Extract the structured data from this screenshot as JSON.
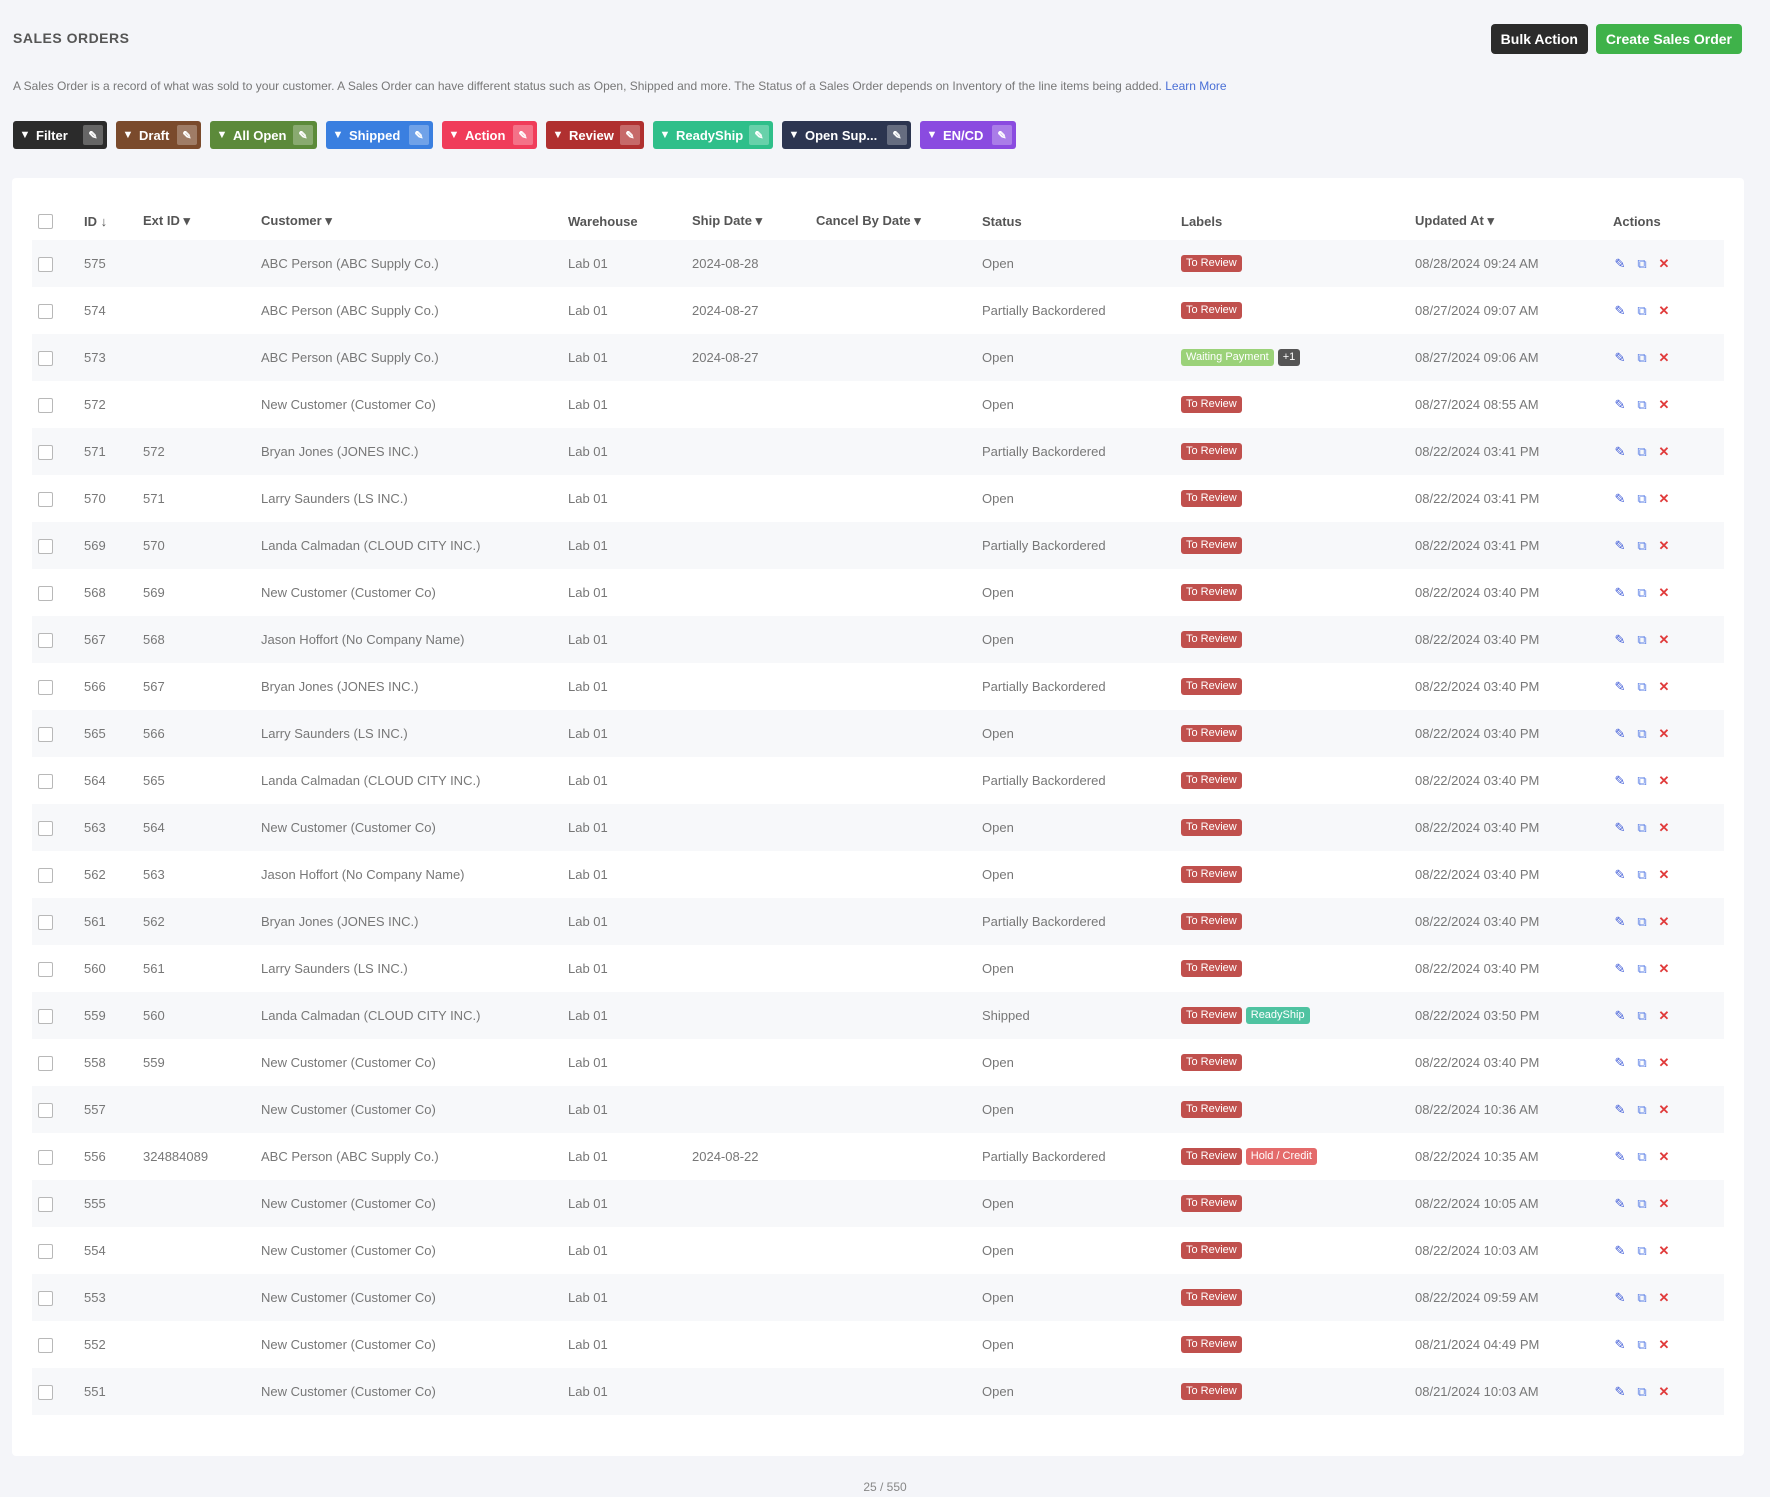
{
  "page": {
    "title": "SALES ORDERS",
    "description": "A Sales Order is a record of what was sold to your customer. A Sales Order can have different status such as Open, Shipped and more. The Status of a Sales Order depends on Inventory of the line items being added.",
    "learn_more": "Learn More",
    "bulk_action": "Bulk Action",
    "create_button": "Create Sales Order"
  },
  "filters": [
    {
      "label": "Filter",
      "color": "#2b2b2b",
      "icon": "filter-icon"
    },
    {
      "label": "Draft",
      "color": "#7a4a2c",
      "icon": "filter-icon"
    },
    {
      "label": "All Open",
      "color": "#5c8a3a",
      "icon": "filter-icon"
    },
    {
      "label": "Shipped",
      "color": "#3a7fe0",
      "icon": "filter-icon"
    },
    {
      "label": "Action",
      "color": "#f03c5a",
      "icon": "filter-icon"
    },
    {
      "label": "Review",
      "color": "#b03030",
      "icon": "filter-icon"
    },
    {
      "label": "ReadyShip",
      "color": "#2fbf8a",
      "icon": "filter-icon"
    },
    {
      "label": "Open Sup...",
      "color": "#2c3550",
      "icon": "filter-icon"
    },
    {
      "label": "EN/CD",
      "color": "#8a4be0",
      "icon": "filter-icon"
    }
  ],
  "table": {
    "columns": [
      "ID",
      "Ext ID",
      "Customer",
      "Warehouse",
      "Ship Date",
      "Cancel By Date",
      "Status",
      "Labels",
      "Updated At",
      "Actions"
    ],
    "rows": [
      {
        "id": "575",
        "ext_id": "",
        "customer": "ABC Person (ABC Supply Co.)",
        "warehouse": "Lab 01",
        "ship_date": "2024-08-28",
        "cancel_by": "",
        "status": "Open",
        "labels": [
          "To Review"
        ],
        "updated": "08/28/2024 09:24 AM"
      },
      {
        "id": "574",
        "ext_id": "",
        "customer": "ABC Person (ABC Supply Co.)",
        "warehouse": "Lab 01",
        "ship_date": "2024-08-27",
        "cancel_by": "",
        "status": "Partially Backordered",
        "labels": [
          "To Review"
        ],
        "updated": "08/27/2024 09:07 AM"
      },
      {
        "id": "573",
        "ext_id": "",
        "customer": "ABC Person (ABC Supply Co.)",
        "warehouse": "Lab 01",
        "ship_date": "2024-08-27",
        "cancel_by": "",
        "status": "Open",
        "labels": [
          "Waiting Payment",
          "+1"
        ],
        "updated": "08/27/2024 09:06 AM"
      },
      {
        "id": "572",
        "ext_id": "",
        "customer": "New Customer (Customer Co)",
        "warehouse": "Lab 01",
        "ship_date": "",
        "cancel_by": "",
        "status": "Open",
        "labels": [
          "To Review"
        ],
        "updated": "08/27/2024 08:55 AM"
      },
      {
        "id": "571",
        "ext_id": "572",
        "customer": "Bryan Jones (JONES INC.)",
        "warehouse": "Lab 01",
        "ship_date": "",
        "cancel_by": "",
        "status": "Partially Backordered",
        "labels": [
          "To Review"
        ],
        "updated": "08/22/2024 03:41 PM"
      },
      {
        "id": "570",
        "ext_id": "571",
        "customer": "Larry Saunders (LS INC.)",
        "warehouse": "Lab 01",
        "ship_date": "",
        "cancel_by": "",
        "status": "Open",
        "labels": [
          "To Review"
        ],
        "updated": "08/22/2024 03:41 PM"
      },
      {
        "id": "569",
        "ext_id": "570",
        "customer": "Landa Calmadan (CLOUD CITY INC.)",
        "warehouse": "Lab 01",
        "ship_date": "",
        "cancel_by": "",
        "status": "Partially Backordered",
        "labels": [
          "To Review"
        ],
        "updated": "08/22/2024 03:41 PM"
      },
      {
        "id": "568",
        "ext_id": "569",
        "customer": "New Customer (Customer Co)",
        "warehouse": "Lab 01",
        "ship_date": "",
        "cancel_by": "",
        "status": "Open",
        "labels": [
          "To Review"
        ],
        "updated": "08/22/2024 03:40 PM"
      },
      {
        "id": "567",
        "ext_id": "568",
        "customer": "Jason Hoffort (No Company Name)",
        "warehouse": "Lab 01",
        "ship_date": "",
        "cancel_by": "",
        "status": "Open",
        "labels": [
          "To Review"
        ],
        "updated": "08/22/2024 03:40 PM"
      },
      {
        "id": "566",
        "ext_id": "567",
        "customer": "Bryan Jones (JONES INC.)",
        "warehouse": "Lab 01",
        "ship_date": "",
        "cancel_by": "",
        "status": "Partially Backordered",
        "labels": [
          "To Review"
        ],
        "updated": "08/22/2024 03:40 PM"
      },
      {
        "id": "565",
        "ext_id": "566",
        "customer": "Larry Saunders (LS INC.)",
        "warehouse": "Lab 01",
        "ship_date": "",
        "cancel_by": "",
        "status": "Open",
        "labels": [
          "To Review"
        ],
        "updated": "08/22/2024 03:40 PM"
      },
      {
        "id": "564",
        "ext_id": "565",
        "customer": "Landa Calmadan (CLOUD CITY INC.)",
        "warehouse": "Lab 01",
        "ship_date": "",
        "cancel_by": "",
        "status": "Partially Backordered",
        "labels": [
          "To Review"
        ],
        "updated": "08/22/2024 03:40 PM"
      },
      {
        "id": "563",
        "ext_id": "564",
        "customer": "New Customer (Customer Co)",
        "warehouse": "Lab 01",
        "ship_date": "",
        "cancel_by": "",
        "status": "Open",
        "labels": [
          "To Review"
        ],
        "updated": "08/22/2024 03:40 PM"
      },
      {
        "id": "562",
        "ext_id": "563",
        "customer": "Jason Hoffort (No Company Name)",
        "warehouse": "Lab 01",
        "ship_date": "",
        "cancel_by": "",
        "status": "Open",
        "labels": [
          "To Review"
        ],
        "updated": "08/22/2024 03:40 PM"
      },
      {
        "id": "561",
        "ext_id": "562",
        "customer": "Bryan Jones (JONES INC.)",
        "warehouse": "Lab 01",
        "ship_date": "",
        "cancel_by": "",
        "status": "Partially Backordered",
        "labels": [
          "To Review"
        ],
        "updated": "08/22/2024 03:40 PM"
      },
      {
        "id": "560",
        "ext_id": "561",
        "customer": "Larry Saunders (LS INC.)",
        "warehouse": "Lab 01",
        "ship_date": "",
        "cancel_by": "",
        "status": "Open",
        "labels": [
          "To Review"
        ],
        "updated": "08/22/2024 03:40 PM"
      },
      {
        "id": "559",
        "ext_id": "560",
        "customer": "Landa Calmadan (CLOUD CITY INC.)",
        "warehouse": "Lab 01",
        "ship_date": "",
        "cancel_by": "",
        "status": "Shipped",
        "labels": [
          "To Review",
          "ReadyShip"
        ],
        "updated": "08/22/2024 03:50 PM"
      },
      {
        "id": "558",
        "ext_id": "559",
        "customer": "New Customer (Customer Co)",
        "warehouse": "Lab 01",
        "ship_date": "",
        "cancel_by": "",
        "status": "Open",
        "labels": [
          "To Review"
        ],
        "updated": "08/22/2024 03:40 PM"
      },
      {
        "id": "557",
        "ext_id": "",
        "customer": "New Customer (Customer Co)",
        "warehouse": "Lab 01",
        "ship_date": "",
        "cancel_by": "",
        "status": "Open",
        "labels": [
          "To Review"
        ],
        "updated": "08/22/2024 10:36 AM"
      },
      {
        "id": "556",
        "ext_id": "324884089",
        "customer": "ABC Person (ABC Supply Co.)",
        "warehouse": "Lab 01",
        "ship_date": "2024-08-22",
        "cancel_by": "",
        "status": "Partially Backordered",
        "labels": [
          "To Review",
          "Hold / Credit"
        ],
        "updated": "08/22/2024 10:35 AM"
      },
      {
        "id": "555",
        "ext_id": "",
        "customer": "New Customer (Customer Co)",
        "warehouse": "Lab 01",
        "ship_date": "",
        "cancel_by": "",
        "status": "Open",
        "labels": [
          "To Review"
        ],
        "updated": "08/22/2024 10:05 AM"
      },
      {
        "id": "554",
        "ext_id": "",
        "customer": "New Customer (Customer Co)",
        "warehouse": "Lab 01",
        "ship_date": "",
        "cancel_by": "",
        "status": "Open",
        "labels": [
          "To Review"
        ],
        "updated": "08/22/2024 10:03 AM"
      },
      {
        "id": "553",
        "ext_id": "",
        "customer": "New Customer (Customer Co)",
        "warehouse": "Lab 01",
        "ship_date": "",
        "cancel_by": "",
        "status": "Open",
        "labels": [
          "To Review"
        ],
        "updated": "08/22/2024 09:59 AM"
      },
      {
        "id": "552",
        "ext_id": "",
        "customer": "New Customer (Customer Co)",
        "warehouse": "Lab 01",
        "ship_date": "",
        "cancel_by": "",
        "status": "Open",
        "labels": [
          "To Review"
        ],
        "updated": "08/21/2024 04:49 PM"
      },
      {
        "id": "551",
        "ext_id": "",
        "customer": "New Customer (Customer Co)",
        "warehouse": "Lab 01",
        "ship_date": "",
        "cancel_by": "",
        "status": "Open",
        "labels": [
          "To Review"
        ],
        "updated": "08/21/2024 10:03 AM"
      }
    ]
  },
  "footer": {
    "pagination": "25 / 550"
  }
}
